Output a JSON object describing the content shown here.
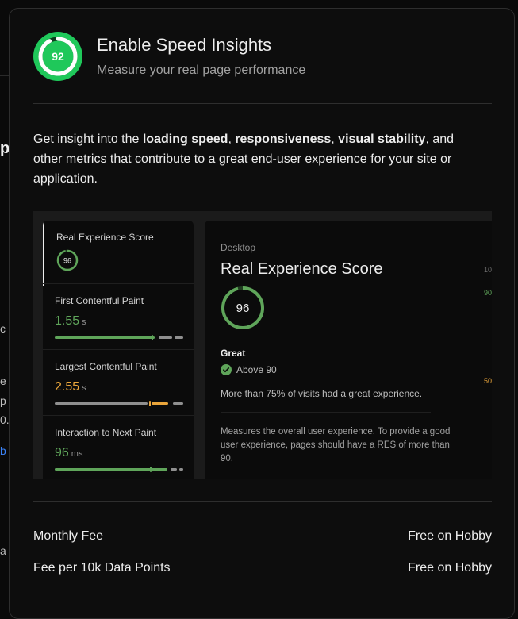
{
  "header": {
    "score": "92",
    "title": "Enable Speed Insights",
    "subtitle": "Measure your real page performance"
  },
  "description": {
    "prefix": "Get insight into the ",
    "b1": "loading speed",
    "sep1": ", ",
    "b2": "responsiveness",
    "sep2": ", ",
    "b3": "visual stability",
    "suffix": ", and other metrics that contribute to a great end-user experience for your site or application."
  },
  "preview": {
    "metrics": [
      {
        "label": "Real Experience Score",
        "score": "96"
      },
      {
        "label": "First Contentful Paint",
        "value": "1.55",
        "unit": "s"
      },
      {
        "label": "Largest Contentful Paint",
        "value": "2.55",
        "unit": "s"
      },
      {
        "label": "Interaction to Next Paint",
        "value": "96",
        "unit": "ms"
      }
    ],
    "detail": {
      "device": "Desktop",
      "title": "Real Experience Score",
      "score": "96",
      "rating": "Great",
      "threshold": "Above 90",
      "summary": "More than 75% of visits had a great experience.",
      "explanation": "Measures the overall user experience. To provide a good user experience, pages should have a RES of more than 90.",
      "axis_labels": [
        "10",
        "90",
        "50"
      ]
    }
  },
  "fees": [
    {
      "label": "Monthly Fee",
      "value": "Free on Hobby"
    },
    {
      "label": "Fee per 10k Data Points",
      "value": "Free on Hobby"
    }
  ],
  "background_fragments": [
    "p",
    "c",
    "e",
    "p",
    "0.",
    "b",
    "a"
  ],
  "colors": {
    "green": "#5fa55a",
    "bright_green": "#22c55e",
    "orange": "#e9a53b",
    "link_blue": "#3b82f6"
  }
}
